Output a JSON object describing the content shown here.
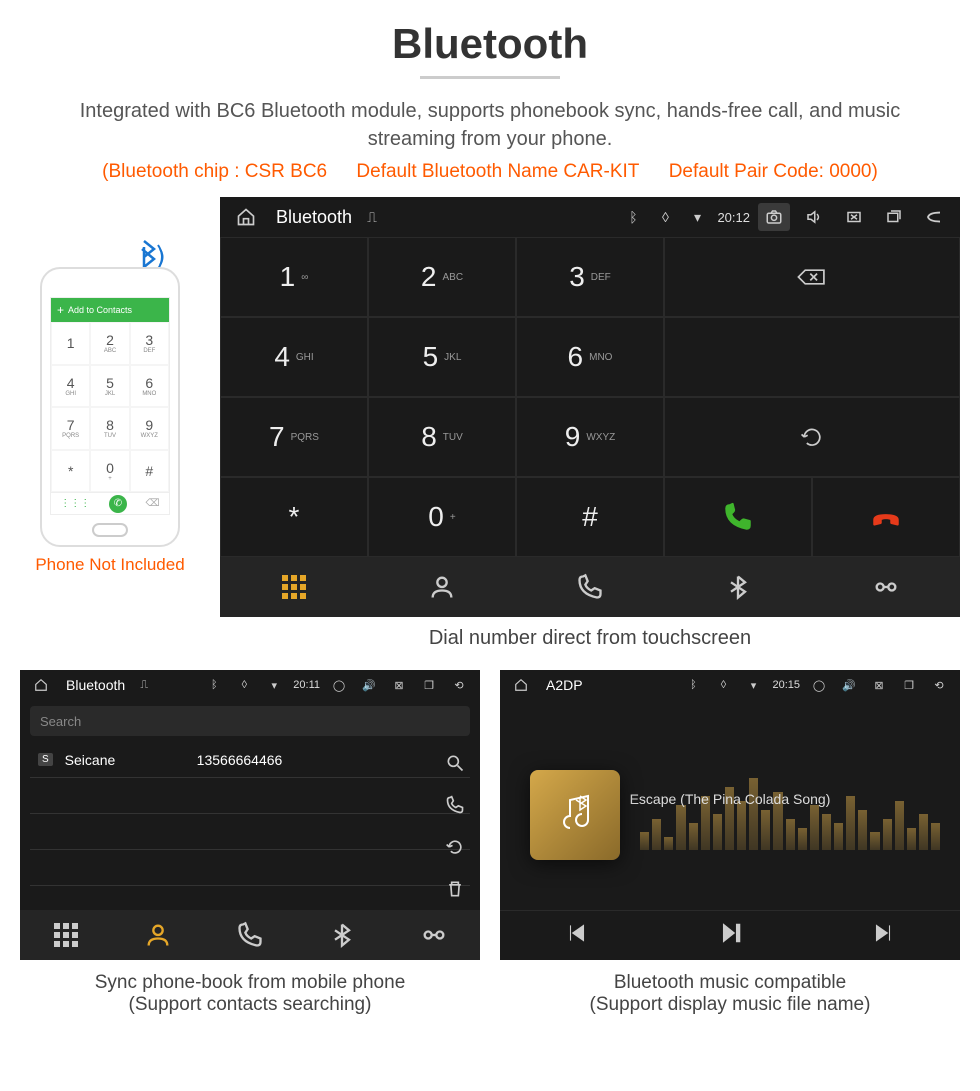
{
  "heading": "Bluetooth",
  "description": "Integrated with BC6 Bluetooth module, supports phonebook sync, hands-free call, and music streaming from your phone.",
  "spec_line": {
    "chip": "(Bluetooth chip : CSR BC6",
    "name": "Default Bluetooth Name CAR-KIT",
    "code": "Default Pair Code: 0000)"
  },
  "phone_mock": {
    "top_label": "Add to Contacts",
    "keys": [
      {
        "n": "1",
        "l": ""
      },
      {
        "n": "2",
        "l": "ABC"
      },
      {
        "n": "3",
        "l": "DEF"
      },
      {
        "n": "4",
        "l": "GHI"
      },
      {
        "n": "5",
        "l": "JKL"
      },
      {
        "n": "6",
        "l": "MNO"
      },
      {
        "n": "7",
        "l": "PQRS"
      },
      {
        "n": "8",
        "l": "TUV"
      },
      {
        "n": "9",
        "l": "WXYZ"
      },
      {
        "n": "*",
        "l": ""
      },
      {
        "n": "0",
        "l": "+"
      },
      {
        "n": "#",
        "l": ""
      }
    ],
    "note": "Phone Not Included"
  },
  "main": {
    "title": "Bluetooth",
    "time": "20:12",
    "keys": [
      {
        "n": "1",
        "l": "∞"
      },
      {
        "n": "2",
        "l": "ABC"
      },
      {
        "n": "3",
        "l": "DEF"
      },
      {
        "n": "4",
        "l": "GHI"
      },
      {
        "n": "5",
        "l": "JKL"
      },
      {
        "n": "6",
        "l": "MNO"
      },
      {
        "n": "7",
        "l": "PQRS"
      },
      {
        "n": "8",
        "l": "TUV"
      },
      {
        "n": "9",
        "l": "WXYZ"
      },
      {
        "n": "*",
        "l": ""
      },
      {
        "n": "0",
        "l": "+"
      },
      {
        "n": "#",
        "l": ""
      }
    ],
    "caption": "Dial number direct from touchscreen"
  },
  "phonebook": {
    "title": "Bluetooth",
    "time": "20:11",
    "search_placeholder": "Search",
    "contact": {
      "tag": "S",
      "name": "Seicane",
      "number": "13566664466"
    },
    "caption1": "Sync phone-book from mobile phone",
    "caption2": "(Support contacts searching)"
  },
  "music": {
    "title": "A2DP",
    "time": "20:15",
    "song": "Escape (The Pina Colada Song)",
    "caption1": "Bluetooth music compatible",
    "caption2": "(Support display music file name)"
  }
}
